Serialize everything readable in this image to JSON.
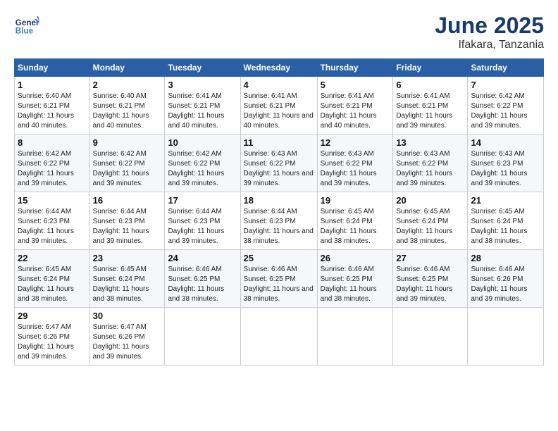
{
  "header": {
    "logo_general": "General",
    "logo_blue": "Blue",
    "title": "June 2025",
    "subtitle": "Ifakara, Tanzania"
  },
  "weekdays": [
    "Sunday",
    "Monday",
    "Tuesday",
    "Wednesday",
    "Thursday",
    "Friday",
    "Saturday"
  ],
  "weeks": [
    [
      {
        "day": "1",
        "sunrise": "6:40 AM",
        "sunset": "6:21 PM",
        "daylight": "11 hours and 40 minutes."
      },
      {
        "day": "2",
        "sunrise": "6:40 AM",
        "sunset": "6:21 PM",
        "daylight": "11 hours and 40 minutes."
      },
      {
        "day": "3",
        "sunrise": "6:41 AM",
        "sunset": "6:21 PM",
        "daylight": "11 hours and 40 minutes."
      },
      {
        "day": "4",
        "sunrise": "6:41 AM",
        "sunset": "6:21 PM",
        "daylight": "11 hours and 40 minutes."
      },
      {
        "day": "5",
        "sunrise": "6:41 AM",
        "sunset": "6:21 PM",
        "daylight": "11 hours and 40 minutes."
      },
      {
        "day": "6",
        "sunrise": "6:41 AM",
        "sunset": "6:21 PM",
        "daylight": "11 hours and 39 minutes."
      },
      {
        "day": "7",
        "sunrise": "6:42 AM",
        "sunset": "6:22 PM",
        "daylight": "11 hours and 39 minutes."
      }
    ],
    [
      {
        "day": "8",
        "sunrise": "6:42 AM",
        "sunset": "6:22 PM",
        "daylight": "11 hours and 39 minutes."
      },
      {
        "day": "9",
        "sunrise": "6:42 AM",
        "sunset": "6:22 PM",
        "daylight": "11 hours and 39 minutes."
      },
      {
        "day": "10",
        "sunrise": "6:42 AM",
        "sunset": "6:22 PM",
        "daylight": "11 hours and 39 minutes."
      },
      {
        "day": "11",
        "sunrise": "6:43 AM",
        "sunset": "6:22 PM",
        "daylight": "11 hours and 39 minutes."
      },
      {
        "day": "12",
        "sunrise": "6:43 AM",
        "sunset": "6:22 PM",
        "daylight": "11 hours and 39 minutes."
      },
      {
        "day": "13",
        "sunrise": "6:43 AM",
        "sunset": "6:22 PM",
        "daylight": "11 hours and 39 minutes."
      },
      {
        "day": "14",
        "sunrise": "6:43 AM",
        "sunset": "6:23 PM",
        "daylight": "11 hours and 39 minutes."
      }
    ],
    [
      {
        "day": "15",
        "sunrise": "6:44 AM",
        "sunset": "6:23 PM",
        "daylight": "11 hours and 39 minutes."
      },
      {
        "day": "16",
        "sunrise": "6:44 AM",
        "sunset": "6:23 PM",
        "daylight": "11 hours and 39 minutes."
      },
      {
        "day": "17",
        "sunrise": "6:44 AM",
        "sunset": "6:23 PM",
        "daylight": "11 hours and 39 minutes."
      },
      {
        "day": "18",
        "sunrise": "6:44 AM",
        "sunset": "6:23 PM",
        "daylight": "11 hours and 38 minutes."
      },
      {
        "day": "19",
        "sunrise": "6:45 AM",
        "sunset": "6:24 PM",
        "daylight": "11 hours and 38 minutes."
      },
      {
        "day": "20",
        "sunrise": "6:45 AM",
        "sunset": "6:24 PM",
        "daylight": "11 hours and 38 minutes."
      },
      {
        "day": "21",
        "sunrise": "6:45 AM",
        "sunset": "6:24 PM",
        "daylight": "11 hours and 38 minutes."
      }
    ],
    [
      {
        "day": "22",
        "sunrise": "6:45 AM",
        "sunset": "6:24 PM",
        "daylight": "11 hours and 38 minutes."
      },
      {
        "day": "23",
        "sunrise": "6:45 AM",
        "sunset": "6:24 PM",
        "daylight": "11 hours and 38 minutes."
      },
      {
        "day": "24",
        "sunrise": "6:46 AM",
        "sunset": "6:25 PM",
        "daylight": "11 hours and 38 minutes."
      },
      {
        "day": "25",
        "sunrise": "6:46 AM",
        "sunset": "6:25 PM",
        "daylight": "11 hours and 38 minutes."
      },
      {
        "day": "26",
        "sunrise": "6:46 AM",
        "sunset": "6:25 PM",
        "daylight": "11 hours and 38 minutes."
      },
      {
        "day": "27",
        "sunrise": "6:46 AM",
        "sunset": "6:25 PM",
        "daylight": "11 hours and 39 minutes."
      },
      {
        "day": "28",
        "sunrise": "6:46 AM",
        "sunset": "6:26 PM",
        "daylight": "11 hours and 39 minutes."
      }
    ],
    [
      {
        "day": "29",
        "sunrise": "6:47 AM",
        "sunset": "6:26 PM",
        "daylight": "11 hours and 39 minutes."
      },
      {
        "day": "30",
        "sunrise": "6:47 AM",
        "sunset": "6:26 PM",
        "daylight": "11 hours and 39 minutes."
      },
      null,
      null,
      null,
      null,
      null
    ]
  ]
}
